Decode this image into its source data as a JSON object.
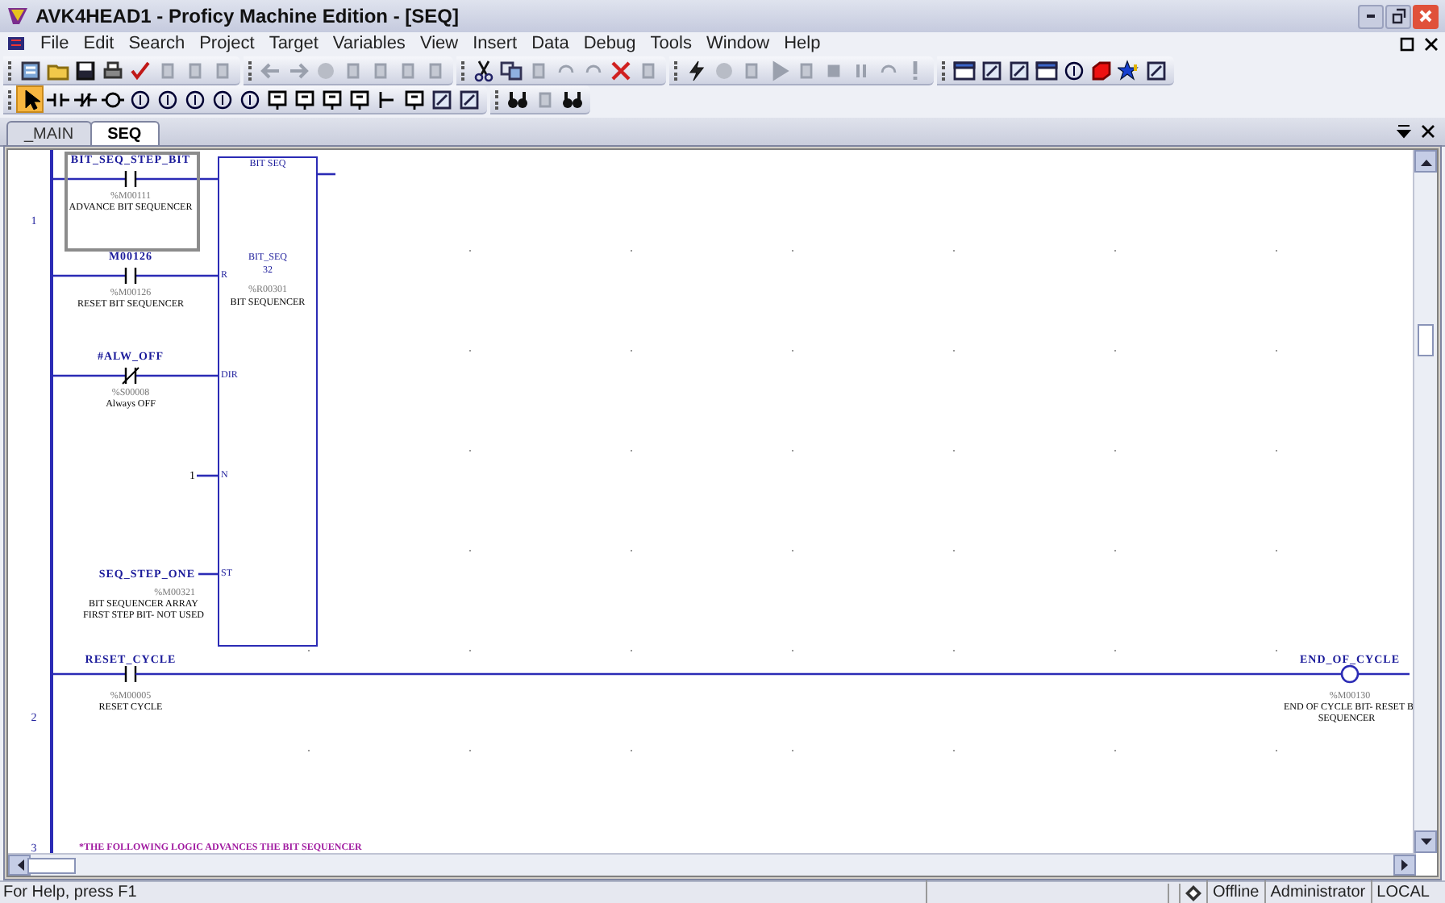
{
  "window": {
    "title": "AVK4HEAD1 - Proficy Machine Edition - [SEQ]"
  },
  "menu": [
    "File",
    "Edit",
    "Search",
    "Project",
    "Target",
    "Variables",
    "View",
    "Insert",
    "Data",
    "Debug",
    "Tools",
    "Window",
    "Help"
  ],
  "tabs": [
    {
      "label": "_MAIN",
      "selected": false
    },
    {
      "label": "SEQ",
      "selected": true
    }
  ],
  "ladder": {
    "rungs": [
      {
        "number": "1",
        "elements": [
          {
            "kind": "contact",
            "name": "BIT_SEQ_STEP_BIT",
            "address": "%M00111",
            "description": [
              "ADVANCE BIT SEQUENCER"
            ],
            "selected": true
          },
          {
            "kind": "contact",
            "name": "M00126",
            "address": "%M00126",
            "description": [
              "RESET BIT SEQUENCER"
            ],
            "selected": false
          },
          {
            "kind": "nc_contact",
            "name": "#ALW_OFF",
            "address": "%S00008",
            "description": [
              "Always OFF"
            ],
            "selected": false
          },
          {
            "kind": "constant",
            "name": "1"
          },
          {
            "kind": "operand",
            "name": "SEQ_STEP_ONE",
            "address": "%M00321",
            "description": [
              "BIT SEQUENCER ARRAY",
              "FIRST STEP BIT- NOT USED"
            ]
          },
          {
            "kind": "block",
            "function": "BIT SEQ",
            "instance": "BIT_SEQ",
            "length": "32",
            "address": "%R00301",
            "description": "BIT SEQUENCER",
            "pins": [
              "R",
              "DIR",
              "N",
              "ST"
            ]
          }
        ]
      },
      {
        "number": "2",
        "elements": [
          {
            "kind": "contact",
            "name": "RESET_CYCLE",
            "address": "%M00005",
            "description": [
              "RESET CYCLE"
            ],
            "selected": false
          },
          {
            "kind": "coil",
            "name": "END_OF_CYCLE",
            "address": "%M00130",
            "description": [
              "END OF CYCLE BIT- RESET B",
              "SEQUENCER"
            ]
          }
        ]
      },
      {
        "number": "3",
        "comment": "*THE FOLLOWING LOGIC ADVANCES THE BIT SEQUENCER"
      }
    ]
  },
  "status_bar": {
    "help": "For Help, press F1",
    "mode": "Offline",
    "user": "Administrator",
    "location": "LOCAL"
  }
}
